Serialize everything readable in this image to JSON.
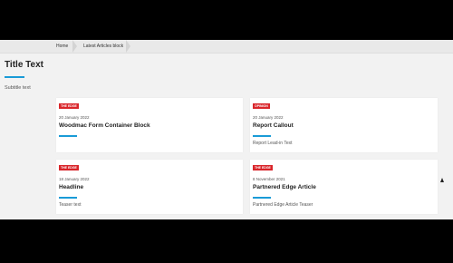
{
  "breadcrumb": {
    "items": [
      "Home",
      "Latest Articles block"
    ]
  },
  "header": {
    "title": "Title Text",
    "subtitle": "Subtitle text"
  },
  "cards": [
    {
      "badge": "THE EDGE",
      "date": "20 January 2022",
      "title": "Woodmac Form Container Block",
      "teaser": ""
    },
    {
      "badge": "OPINION",
      "date": "20 January 2022",
      "title": "Report Callout",
      "teaser": "Report Lead-in Text"
    },
    {
      "badge": "THE EDGE",
      "date": "18 January 2022",
      "title": "Headline",
      "teaser": "Teaser text"
    },
    {
      "badge": "THE EDGE",
      "date": "8 November 2021",
      "title": "Partnered Edge Article",
      "teaser": "Partnered Edge Article Teaser"
    }
  ],
  "colors": {
    "accent": "#1a9bd7",
    "badge": "#d9252a",
    "background": "#f2f2f2"
  }
}
